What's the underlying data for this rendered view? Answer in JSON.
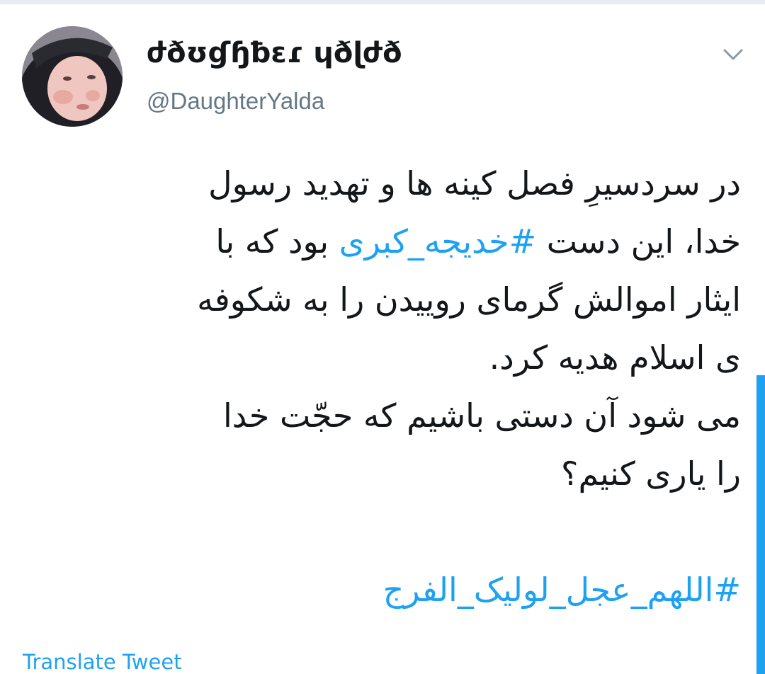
{
  "tweet": {
    "display_name": "ժðʊɠɧƀɛɾ ɥðɭժð",
    "handle": "@DaughterYalda",
    "text": {
      "line1": "در سردسیرِ فصل کینه ها و تهدید رسول",
      "line2_before": "خدا، این دست",
      "line2_hashtag": "#خدیجه_کبری",
      "line2_after": "بود که با",
      "line3": "ایثار اموالش گرمای روییدن را به شکوفه",
      "line4": "ی اسلام هدیه کرد.",
      "line5": "می شود آن دستی باشیم که حجّت خدا",
      "line6": "را یاری کنیم؟",
      "final_hashtag": "#اللهم_عجل_لولیک_الفرج"
    },
    "translate_label": "Translate Tweet"
  },
  "icons": {
    "menu": "chevron-down-icon",
    "avatar": "avatar-photo"
  },
  "colors": {
    "link": "#1da1f2",
    "text": "#14171a",
    "secondary": "#657786",
    "divider": "#e6ecf0"
  }
}
